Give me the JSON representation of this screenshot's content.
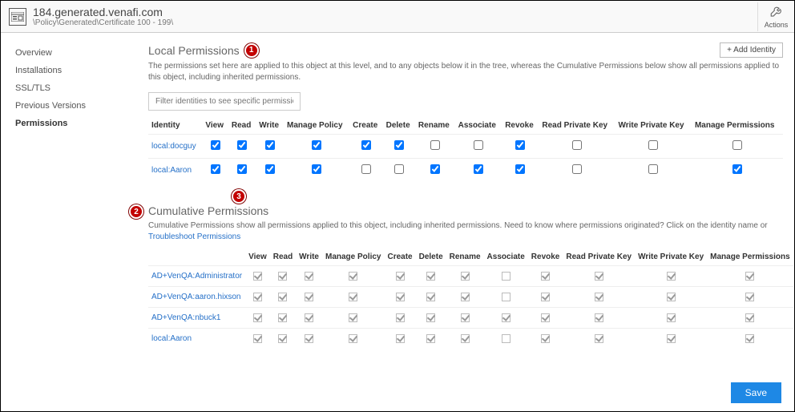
{
  "header": {
    "title": "184.generated.venafi.com",
    "breadcrumb": "\\Policy\\Generated\\Certificate 100 - 199\\",
    "actions_label": "Actions"
  },
  "sidebar": {
    "items": [
      "Overview",
      "Installations",
      "SSL/TLS",
      "Previous Versions",
      "Permissions"
    ],
    "active": 4
  },
  "local": {
    "title": "Local Permissions",
    "desc": "The permissions set here are applied to this object at this level, and to any objects below it in the tree, whereas the Cumulative Permissions below show all permissions applied to this object, including inherited permissions.",
    "add_btn": "+ Add Identity",
    "filter_placeholder": "Filter identities to see specific permissions",
    "columns": [
      "Identity",
      "View",
      "Read",
      "Write",
      "Manage Policy",
      "Create",
      "Delete",
      "Rename",
      "Associate",
      "Revoke",
      "Read Private Key",
      "Write Private Key",
      "Manage Permissions"
    ],
    "rows": [
      {
        "identity": "local:docguy",
        "perms": [
          true,
          true,
          true,
          true,
          true,
          true,
          false,
          false,
          true,
          false,
          false,
          false
        ]
      },
      {
        "identity": "local:Aaron",
        "perms": [
          true,
          true,
          true,
          true,
          false,
          false,
          true,
          true,
          true,
          false,
          false,
          true
        ]
      }
    ]
  },
  "cumulative": {
    "title": "Cumulative Permissions",
    "desc_pre": "Cumulative Permissions show all permissions applied to this object, including inherited permissions. Need to know where permissions originated? Click on the identity name or ",
    "desc_link": "Troubleshoot Permissions",
    "columns": [
      "View",
      "Read",
      "Write",
      "Manage Policy",
      "Create",
      "Delete",
      "Rename",
      "Associate",
      "Revoke",
      "Read Private Key",
      "Write Private Key",
      "Manage Permissions"
    ],
    "rows": [
      {
        "identity": "AD+VenQA:Administrator",
        "perms": [
          true,
          true,
          true,
          true,
          true,
          true,
          true,
          false,
          true,
          true,
          true,
          true
        ]
      },
      {
        "identity": "AD+VenQA:aaron.hixson",
        "perms": [
          true,
          true,
          true,
          true,
          true,
          true,
          true,
          false,
          true,
          true,
          true,
          true
        ]
      },
      {
        "identity": "AD+VenQA:nbuck1",
        "perms": [
          true,
          true,
          true,
          true,
          true,
          true,
          true,
          true,
          true,
          true,
          true,
          true
        ]
      },
      {
        "identity": "local:Aaron",
        "perms": [
          true,
          true,
          true,
          true,
          true,
          true,
          true,
          false,
          true,
          true,
          true,
          true
        ]
      }
    ]
  },
  "save_label": "Save",
  "callouts": [
    "1",
    "2",
    "3"
  ]
}
